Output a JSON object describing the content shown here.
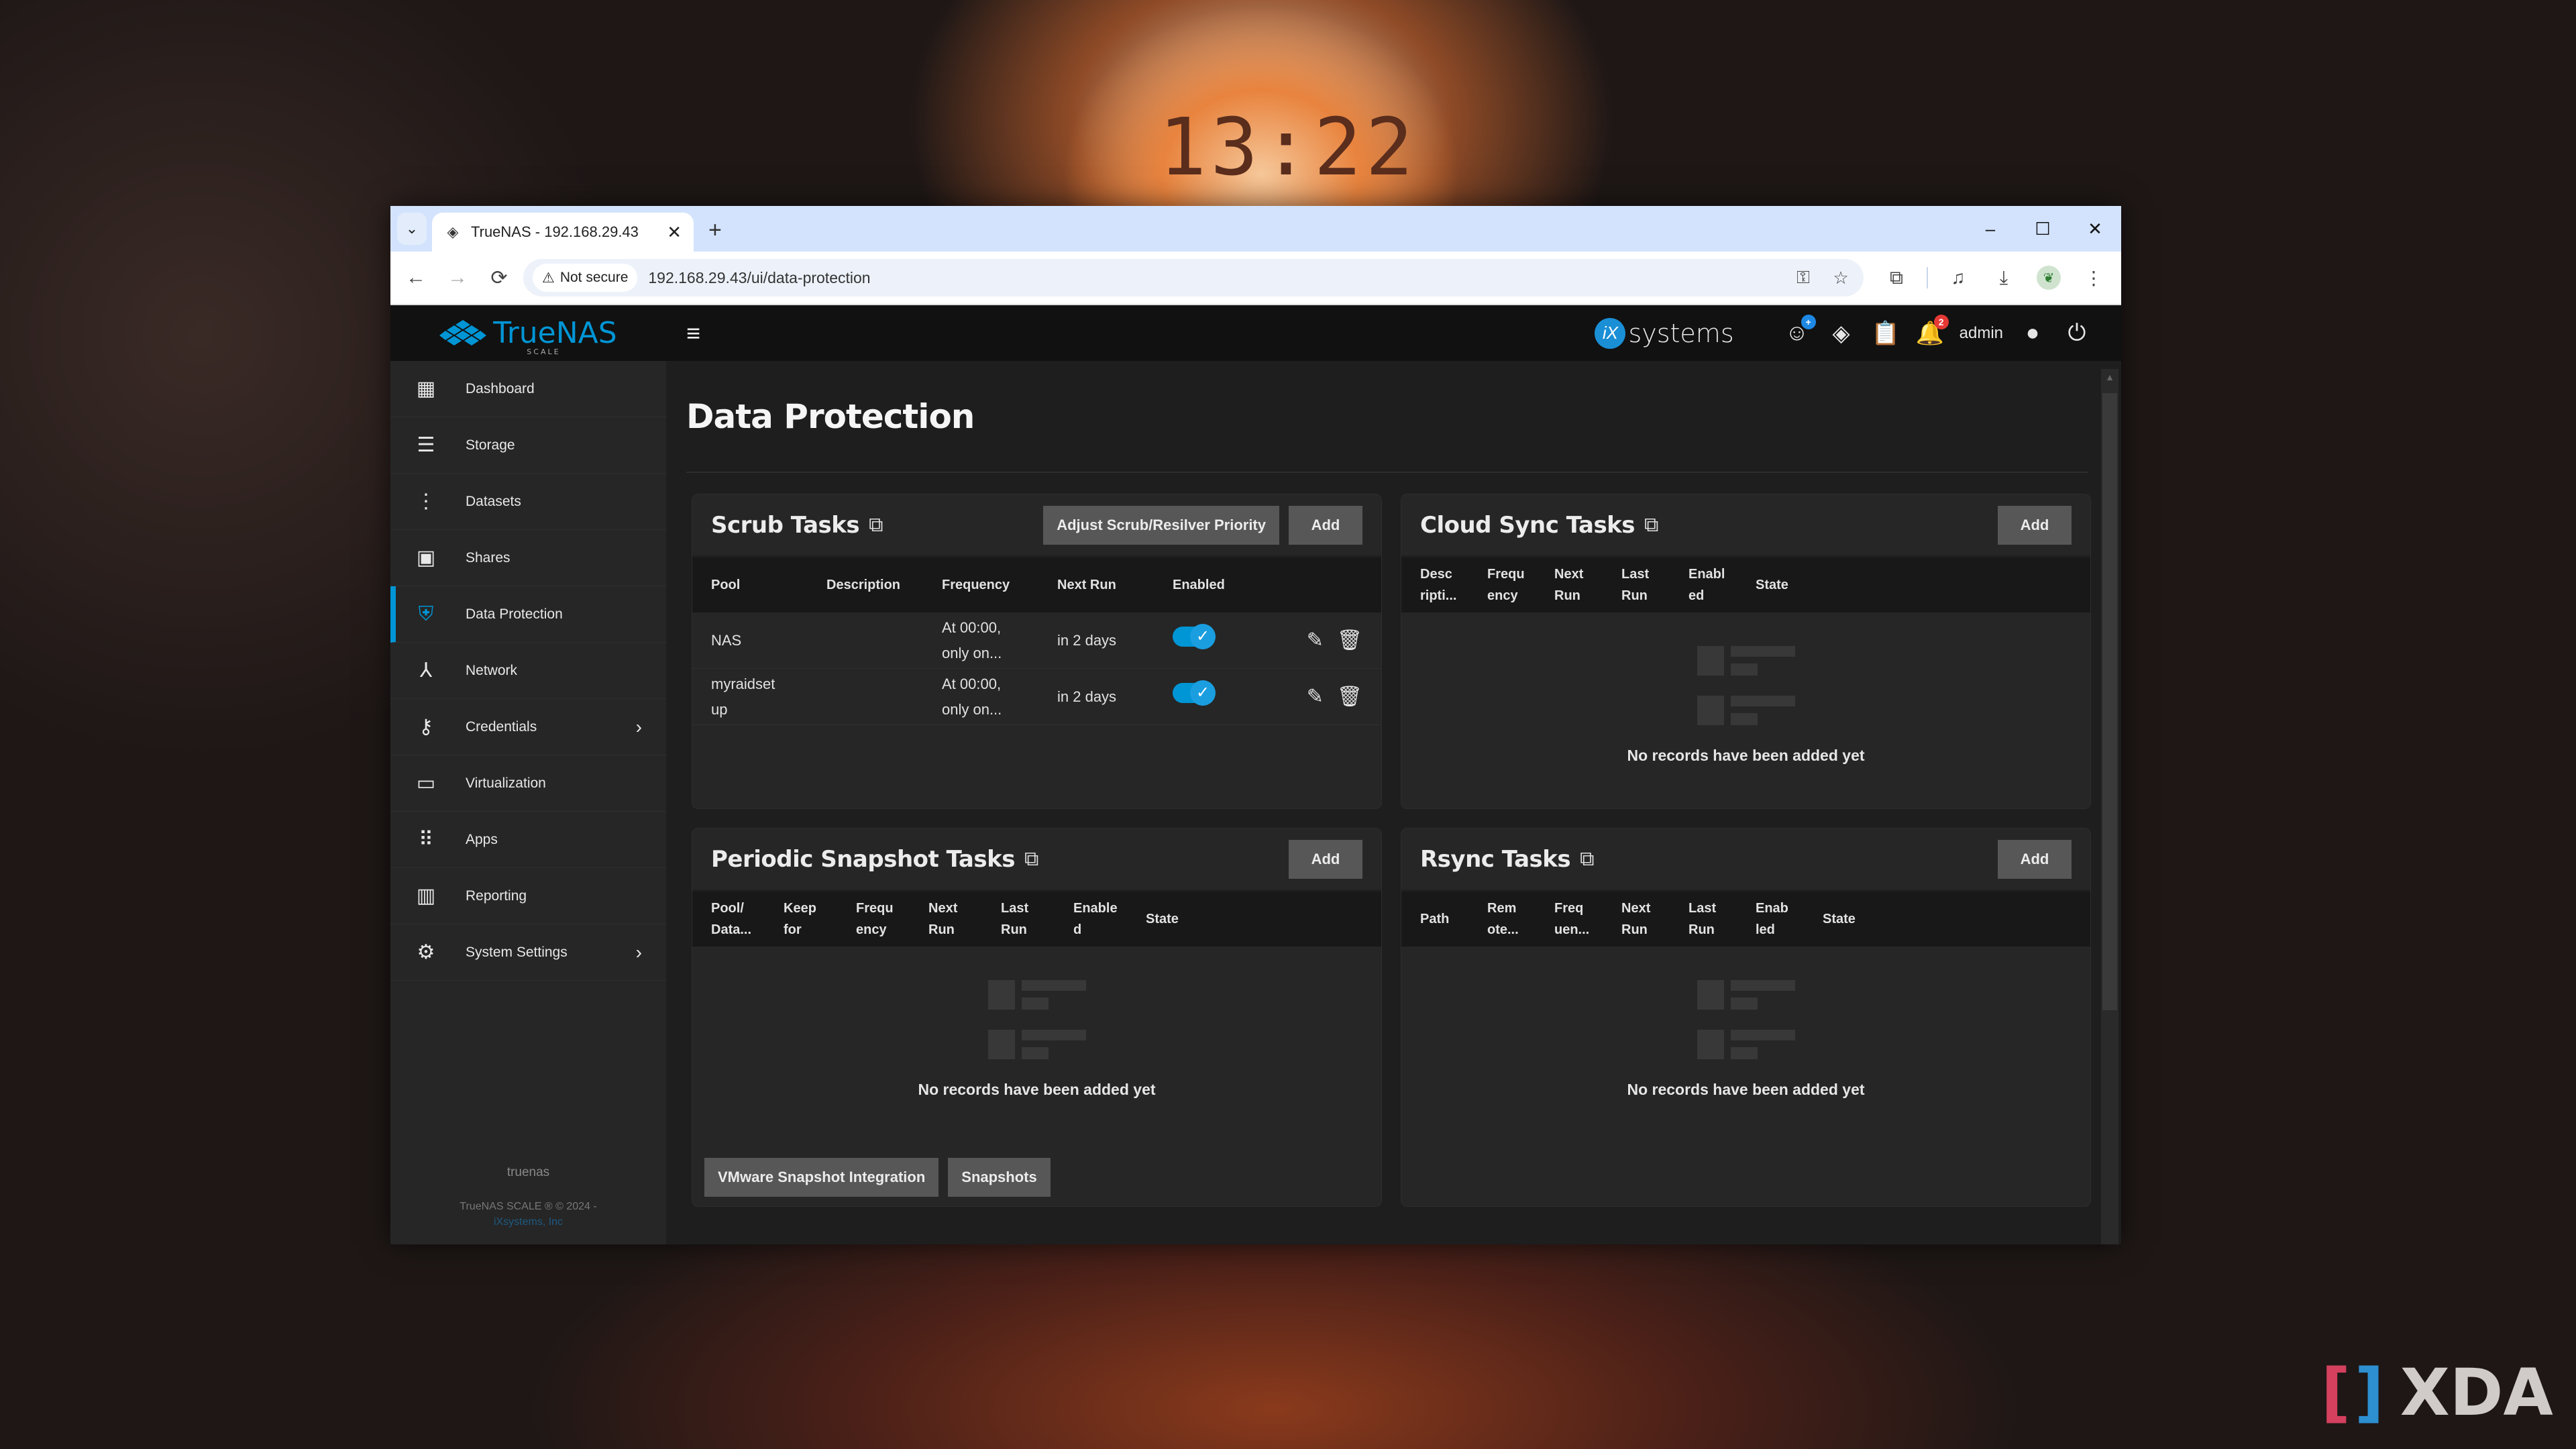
{
  "desktop": {
    "clock": "13:22",
    "watermark": {
      "left_bracket": "[",
      "right_bracket": "]",
      "text": "XDA"
    }
  },
  "browser": {
    "tab_title": "TrueNAS - 192.168.29.43",
    "new_tab": "+",
    "window_controls": {
      "minimize": "–",
      "maximize": "☐",
      "close": "✕"
    },
    "security_label": "Not secure",
    "url": "192.168.29.43/ui/data-protection",
    "icons": {
      "back": "←",
      "forward": "→",
      "reload": "⟳",
      "warning": "⚠",
      "key": "⚿",
      "star": "☆",
      "extensions": "⧉",
      "media": "♫",
      "download": "⤓",
      "menu": "⋮",
      "tab_dropdown": "⌄",
      "tab_close": "✕",
      "profile": "❦"
    }
  },
  "header": {
    "brand_name": "TrueNAS",
    "brand_edition": "SCALE",
    "vendor_logo": "iX",
    "vendor_text": "systems",
    "user": "admin",
    "notification_count": "2",
    "feedback_badge": "+",
    "icons": {
      "menu": "≡",
      "feedback": "☺",
      "truecommand": "◈",
      "jobs": "📋",
      "alerts": "🔔",
      "account": "●",
      "power": "⏻"
    }
  },
  "sidebar": {
    "items": [
      {
        "label": "Dashboard",
        "icon": "▦",
        "active": false,
        "has_children": false
      },
      {
        "label": "Storage",
        "icon": "☰",
        "active": false,
        "has_children": false
      },
      {
        "label": "Datasets",
        "icon": "⋮",
        "active": false,
        "has_children": false
      },
      {
        "label": "Shares",
        "icon": "▣",
        "active": false,
        "has_children": false
      },
      {
        "label": "Data Protection",
        "icon": "⛨",
        "active": true,
        "has_children": false
      },
      {
        "label": "Network",
        "icon": "⅄",
        "active": false,
        "has_children": false
      },
      {
        "label": "Credentials",
        "icon": "⚷",
        "active": false,
        "has_children": true
      },
      {
        "label": "Virtualization",
        "icon": "▭",
        "active": false,
        "has_children": false
      },
      {
        "label": "Apps",
        "icon": "⠿",
        "active": false,
        "has_children": false
      },
      {
        "label": "Reporting",
        "icon": "▥",
        "active": false,
        "has_children": false
      },
      {
        "label": "System Settings",
        "icon": "⚙",
        "active": false,
        "has_children": true
      }
    ],
    "chevron": "›",
    "footer": {
      "hostname": "truenas",
      "copyright": "TrueNAS SCALE ® © 2024 -",
      "company_link": "iXsystems, Inc"
    }
  },
  "page": {
    "title": "Data Protection",
    "external_icon": "⧉",
    "empty_text": "No records have been added yet",
    "cards": {
      "scrub": {
        "title": "Scrub Tasks",
        "actions": [
          "Adjust Scrub/Resilver Priority",
          "Add"
        ],
        "columns": [
          "Pool",
          "Description",
          "Frequency",
          "Next Run",
          "Enabled"
        ],
        "rows": [
          {
            "pool": "NAS",
            "description": "",
            "frequency": "At 00:00, only on...",
            "frequency_l1": "At 00:00,",
            "frequency_l2": "only on...",
            "next_run": "in 2 days",
            "enabled": true
          },
          {
            "pool": "myraidsetup",
            "pool_l1": "myraidset",
            "pool_l2": "up",
            "description": "",
            "frequency": "At 00:00, only on...",
            "frequency_l1": "At 00:00,",
            "frequency_l2": "only on...",
            "next_run": "in 2 days",
            "enabled": true
          }
        ],
        "row_icons": {
          "edit": "✎",
          "delete": "🗑",
          "check": "✓"
        }
      },
      "cloud_sync": {
        "title": "Cloud Sync Tasks",
        "add": "Add",
        "columns": [
          [
            "Desc",
            "ripti..."
          ],
          [
            "Frequ",
            "ency"
          ],
          [
            "Next",
            "Run"
          ],
          [
            "Last",
            "Run"
          ],
          [
            "Enabl",
            "ed"
          ],
          [
            "State",
            ""
          ]
        ]
      },
      "snapshot": {
        "title": "Periodic Snapshot Tasks",
        "add": "Add",
        "columns": [
          [
            "Pool/",
            "Data..."
          ],
          [
            "Keep",
            "for"
          ],
          [
            "Frequ",
            "ency"
          ],
          [
            "Next",
            "Run"
          ],
          [
            "Last",
            "Run"
          ],
          [
            "Enable",
            "d"
          ],
          [
            "State",
            ""
          ]
        ],
        "footer_buttons": [
          "VMware Snapshot Integration",
          "Snapshots"
        ]
      },
      "rsync": {
        "title": "Rsync Tasks",
        "add": "Add",
        "columns": [
          [
            "Path",
            ""
          ],
          [
            "Rem",
            "ote..."
          ],
          [
            "Freq",
            "uen..."
          ],
          [
            "Next",
            "Run"
          ],
          [
            "Last",
            "Run"
          ],
          [
            "Enab",
            "led"
          ],
          [
            "State",
            ""
          ]
        ]
      }
    }
  }
}
